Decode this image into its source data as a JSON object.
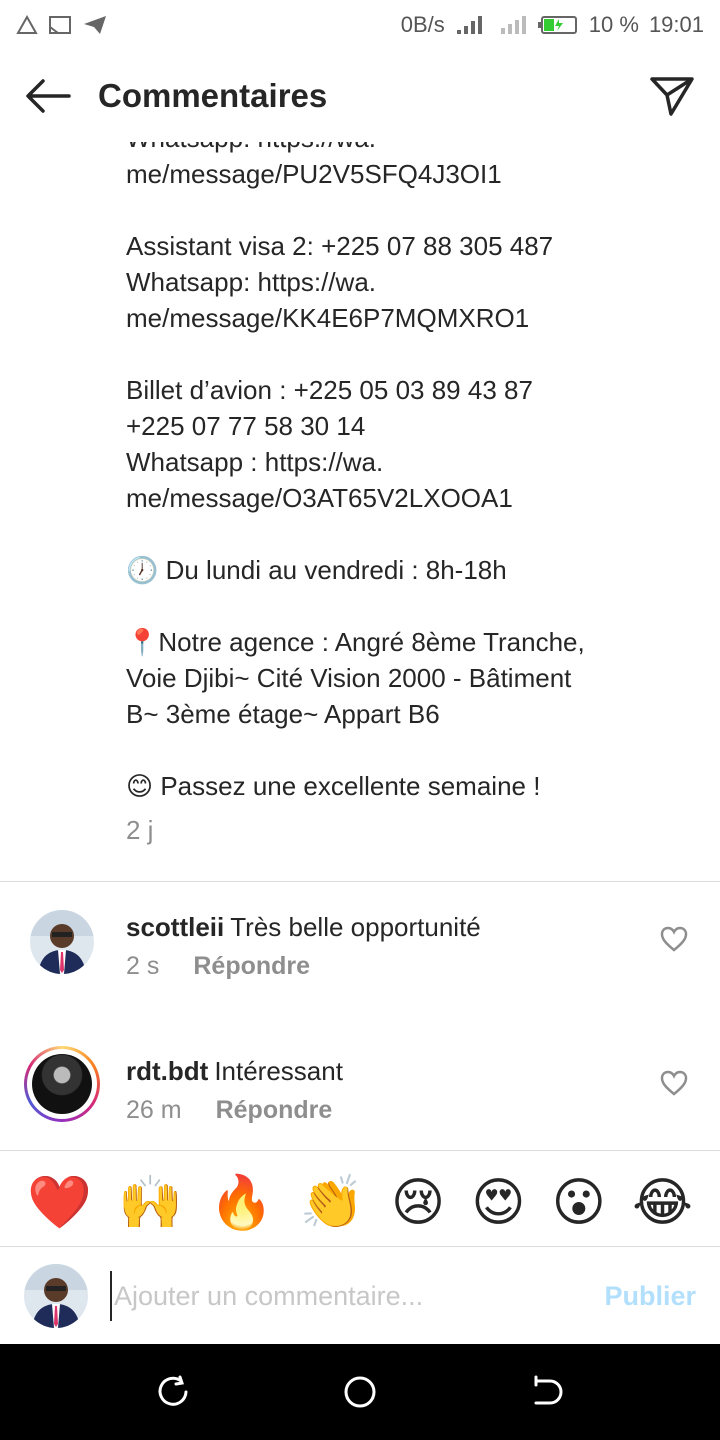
{
  "status": {
    "speed": "0B/s",
    "battery": "10 %",
    "time": "19:01",
    "icons": [
      "warning-icon",
      "cast-icon",
      "telegram-icon",
      "signal-icon",
      "wifi-icon",
      "battery-icon"
    ]
  },
  "header": {
    "title": "Commentaires",
    "back_icon": "arrow-left-icon",
    "send_icon": "send-icon"
  },
  "caption": {
    "lines": [
      "Whatsapp: https://wa.",
      "me/message/PU2V5SFQ4J3OI1",
      "",
      "Assistant visa 2: +225 07 88 305 487",
      "Whatsapp: https://wa.",
      "me/message/KK4E6P7MQMXRO1",
      "",
      "Billet d’avion : +225 05 03 89 43 87",
      "+225 07 77 58 30 14",
      "Whatsapp : https://wa.",
      "me/message/O3AT65V2LXOOA1",
      "",
      "🕖 Du lundi au vendredi : 8h-18h",
      "",
      "📍Notre agence : Angré 8ème Tranche,",
      "Voie Djibi~ Cité Vision 2000 - Bâtiment",
      "B~ 3ème étage~ Appart B6",
      "",
      "😊 Passez une excellente semaine !"
    ],
    "time": "2 j"
  },
  "comments": [
    {
      "user": "scottleii",
      "text": "Très belle opportunité",
      "time": "2 s",
      "reply": "Répondre"
    },
    {
      "user": "rdt.bdt",
      "text": "Intéressant",
      "time": "26 m",
      "reply": "Répondre"
    }
  ],
  "emojis": [
    "❤️",
    "🙌",
    "🔥",
    "👏",
    "😢",
    "😍",
    "😮",
    "😂"
  ],
  "input": {
    "placeholder": "Ajouter un commentaire...",
    "publish": "Publier"
  },
  "nav": [
    "recent-apps-icon",
    "home-icon",
    "back-icon"
  ]
}
